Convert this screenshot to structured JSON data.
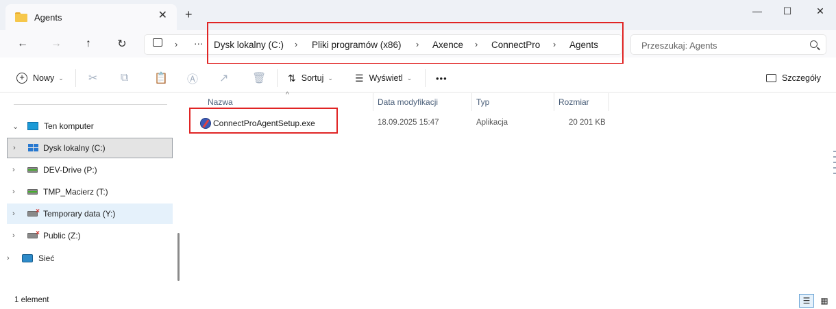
{
  "window": {
    "tab_title": "Agents",
    "tab_close": "✕",
    "new_tab": "+",
    "minimize": "—",
    "maximize": "☐",
    "close": "✕"
  },
  "nav": {
    "back": "←",
    "forward": "→",
    "up": "↑",
    "refresh": "↻",
    "more": "···",
    "breadcrumb": [
      "Dysk lokalny (C:)",
      "Pliki programów (x86)",
      "Axence",
      "ConnectPro",
      "Agents"
    ],
    "separator": "›",
    "search_placeholder": "Przeszukaj: Agents"
  },
  "toolbar": {
    "new_label": "Nowy",
    "sort_label": "Sortuj",
    "view_label": "Wyświetl",
    "more_label": "•••",
    "details_label": "Szczegóły"
  },
  "sidebar": {
    "items": [
      {
        "label": "Ten komputer",
        "icon": "computer-icon"
      },
      {
        "label": "Dysk lokalny (C:)",
        "icon": "windows-drive-icon"
      },
      {
        "label": "DEV-Drive (P:)",
        "icon": "drive-icon"
      },
      {
        "label": "TMP_Macierz (T:)",
        "icon": "drive-icon"
      },
      {
        "label": "Temporary data (Y:)",
        "icon": "network-drive-disconnected-icon"
      },
      {
        "label": "Public (Z:)",
        "icon": "network-drive-disconnected-icon"
      },
      {
        "label": "Sieć",
        "icon": "network-icon"
      }
    ]
  },
  "columns": {
    "name": "Nazwa",
    "date": "Data modyfikacji",
    "type": "Typ",
    "size": "Rozmiar"
  },
  "files": [
    {
      "name": "ConnectProAgentSetup.exe",
      "date": "18.09.2025 15:47",
      "type": "Aplikacja",
      "size": "20 201 KB"
    }
  ],
  "status": {
    "count": "1 element"
  },
  "colors": {
    "highlight": "#e02424",
    "accent": "#0067c0"
  }
}
